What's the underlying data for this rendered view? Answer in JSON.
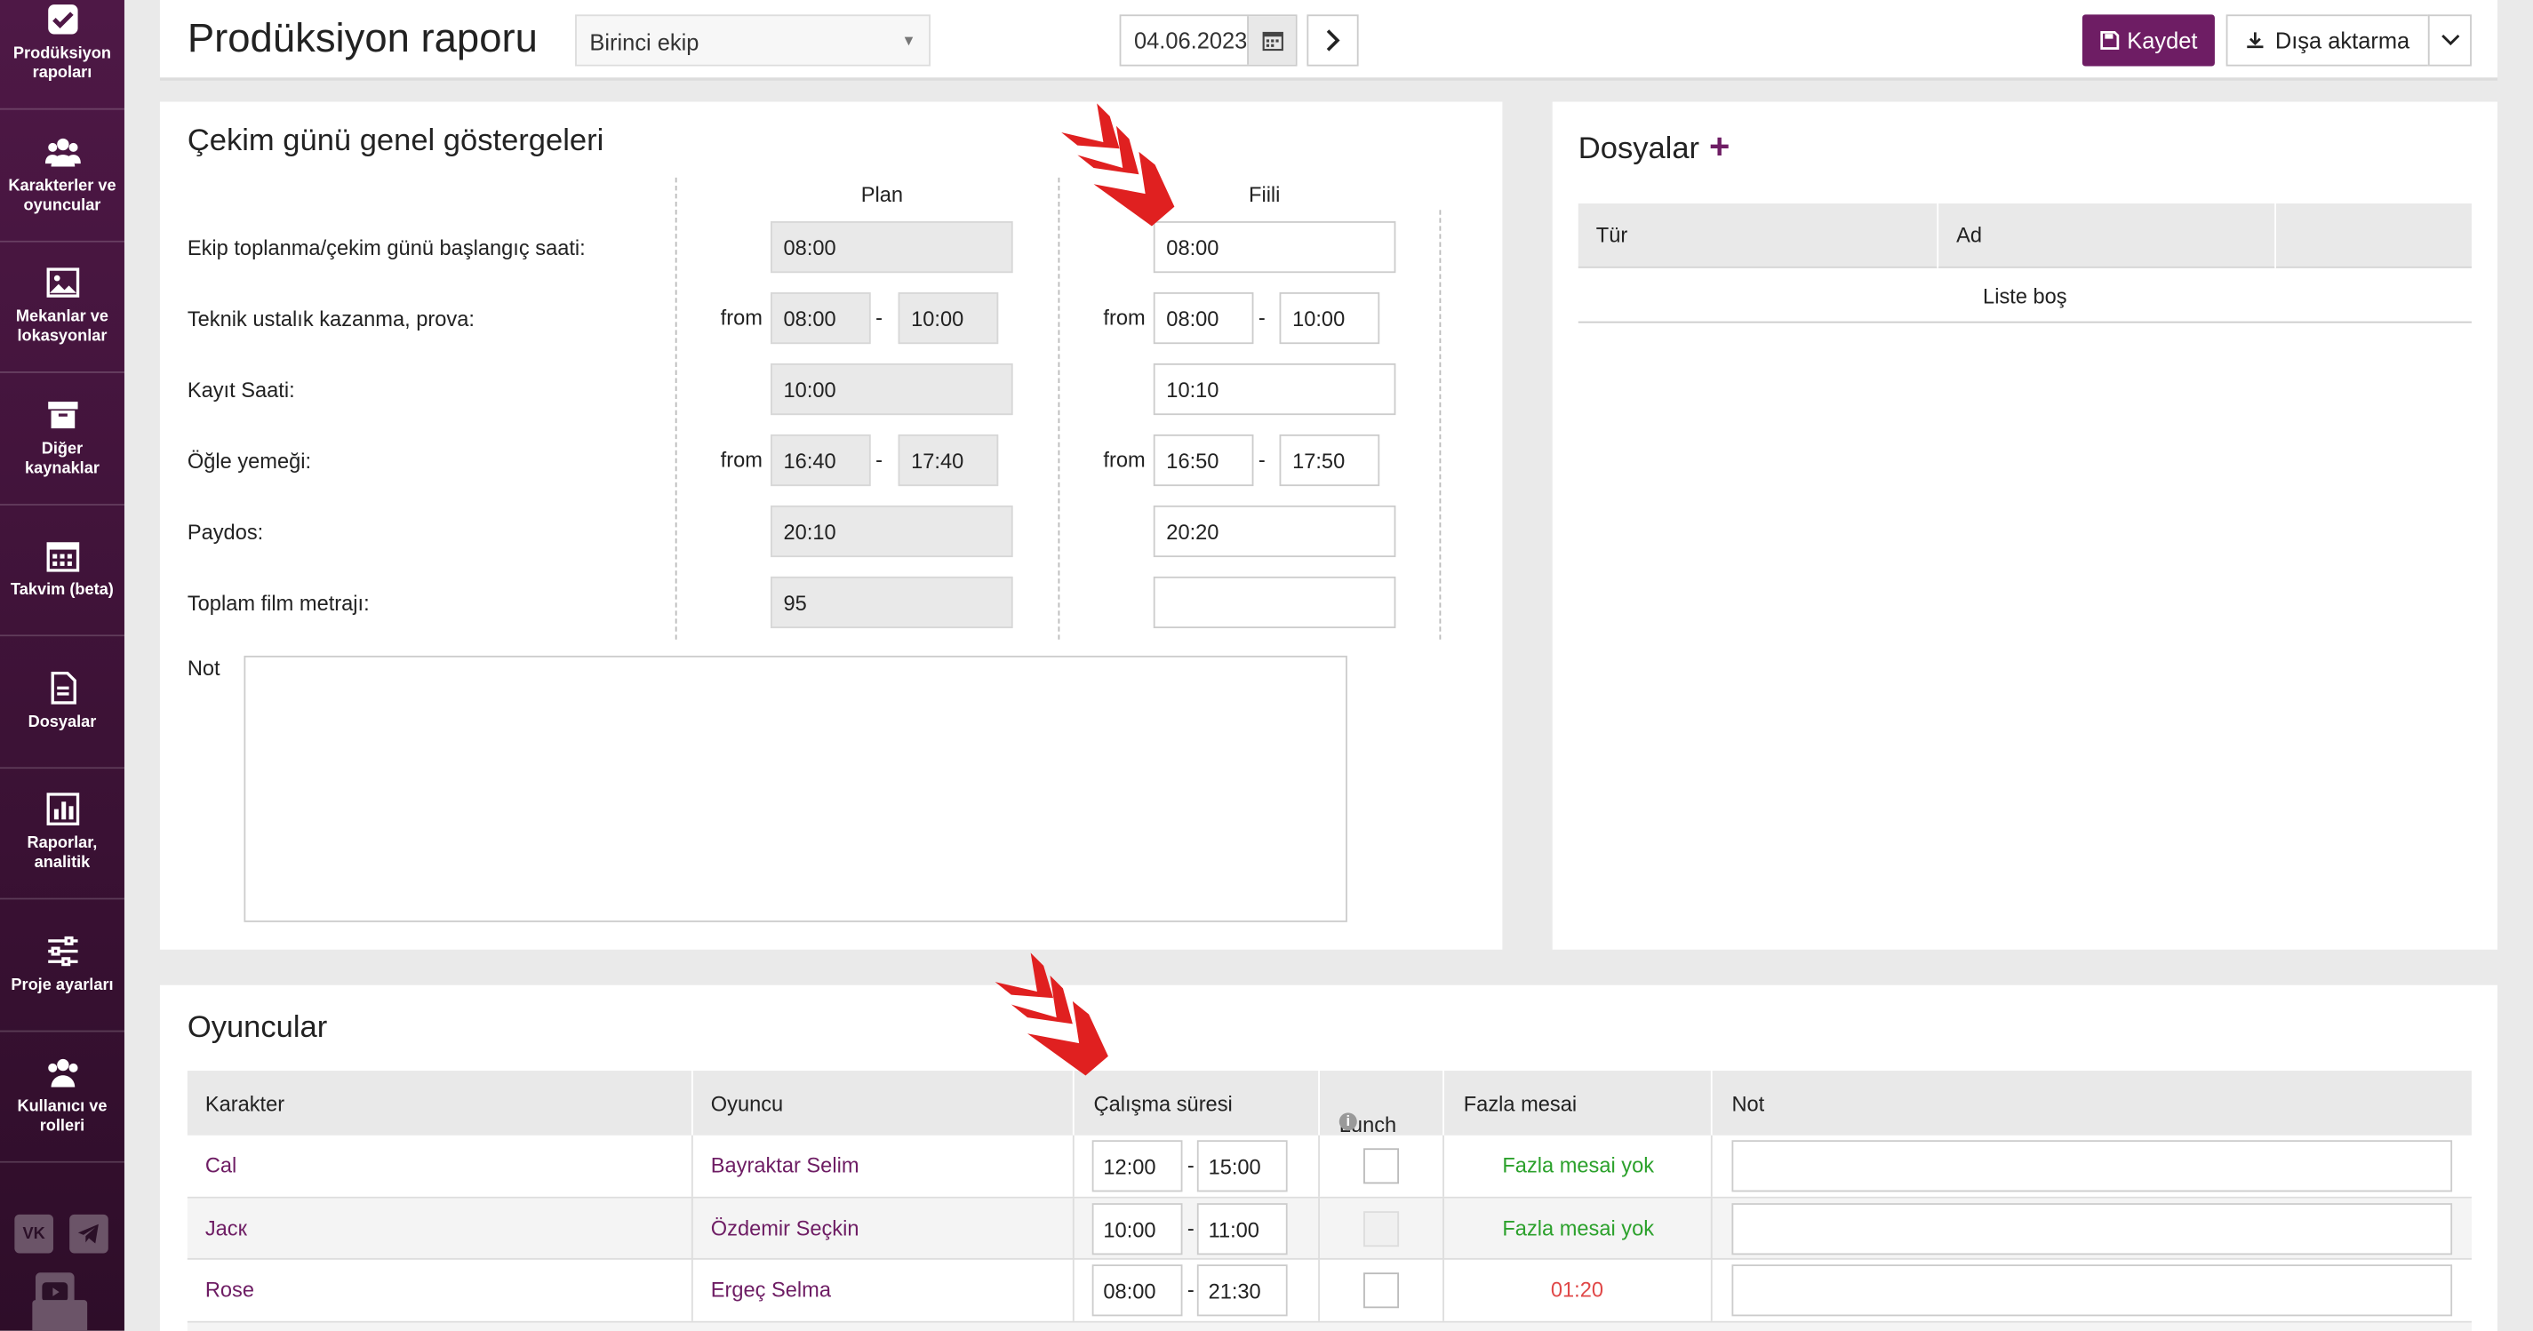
{
  "sidebar": {
    "items": [
      {
        "label": "Prodüksiyon rapoları",
        "icon": "checkbox-icon"
      },
      {
        "label": "Karakterler ve oyuncular",
        "icon": "users-icon"
      },
      {
        "label": "Mekanlar ve lokasyonlar",
        "icon": "image-icon"
      },
      {
        "label": "Diğer kaynaklar",
        "icon": "archive-icon"
      },
      {
        "label": "Takvim (beta)",
        "icon": "calendar-icon"
      },
      {
        "label": "Dosyalar",
        "icon": "file-icon"
      },
      {
        "label": "Raporlar, analitik",
        "icon": "bar-chart-icon"
      },
      {
        "label": "Proje ayarları",
        "icon": "sliders-icon"
      },
      {
        "label": "Kullanıcı ve rolleri",
        "icon": "users-icon"
      }
    ],
    "social": [
      "vk-icon",
      "telegram-icon",
      "youtube-icon"
    ]
  },
  "header": {
    "title": "Prodüksiyon raporu",
    "team_select": "Birinci ekip",
    "date": "04.06.2023",
    "save_label": "Kaydet",
    "export_label": "Dışa aktarma"
  },
  "indicators": {
    "title": "Çekim günü genel göstergeleri",
    "plan_label": "Plan",
    "actual_label": "Fiili",
    "from_label": "from",
    "dash": "-",
    "rows": [
      {
        "label": "Ekip toplanma/çekim günü başlangıç saati:",
        "plan": "08:00",
        "actual": "08:00"
      },
      {
        "label": "Teknik ustalık kazanma, prova:",
        "plan_from": "08:00",
        "plan_to": "10:00",
        "actual_from": "08:00",
        "actual_to": "10:00"
      },
      {
        "label": "Kayıt Saati:",
        "plan": "10:00",
        "actual": "10:10"
      },
      {
        "label": "Öğle yemeği:",
        "plan_from": "16:40",
        "plan_to": "17:40",
        "actual_from": "16:50",
        "actual_to": "17:50"
      },
      {
        "label": "Paydos:",
        "plan": "20:10",
        "actual": "20:20"
      },
      {
        "label": "Toplam film metrajı:",
        "plan": "95",
        "actual": ""
      }
    ],
    "note_label": "Not",
    "note_value": ""
  },
  "files": {
    "title": "Dosyalar",
    "add": "+",
    "columns": [
      "Tür",
      "Ad"
    ],
    "empty": "Liste boş"
  },
  "actors": {
    "title": "Oyuncular",
    "columns": [
      "Karakter",
      "Oyuncu",
      "Çalışma süresi",
      "Lunch",
      "Fazla mesai",
      "Not"
    ],
    "rows": [
      {
        "character": "Cal",
        "actor": "Bayraktar Selim",
        "from": "12:00",
        "to": "15:00",
        "lunch": false,
        "overtime": "Fazla mesai yok",
        "overtime_status": "ok"
      },
      {
        "character": "Jacк",
        "actor": "Özdemir Seçkin",
        "from": "10:00",
        "to": "11:00",
        "lunch": false,
        "overtime": "Fazla mesai yok",
        "overtime_status": "ok"
      },
      {
        "character": "Rose",
        "actor": "Ergeç Selma",
        "from": "08:00",
        "to": "21:30",
        "lunch": false,
        "overtime": "01:20",
        "overtime_status": "bad"
      }
    ]
  },
  "colors": {
    "brand": "#6e1d64",
    "accent_arrow": "#e02020",
    "ok": "#2ca12c",
    "bad": "#e04848"
  }
}
